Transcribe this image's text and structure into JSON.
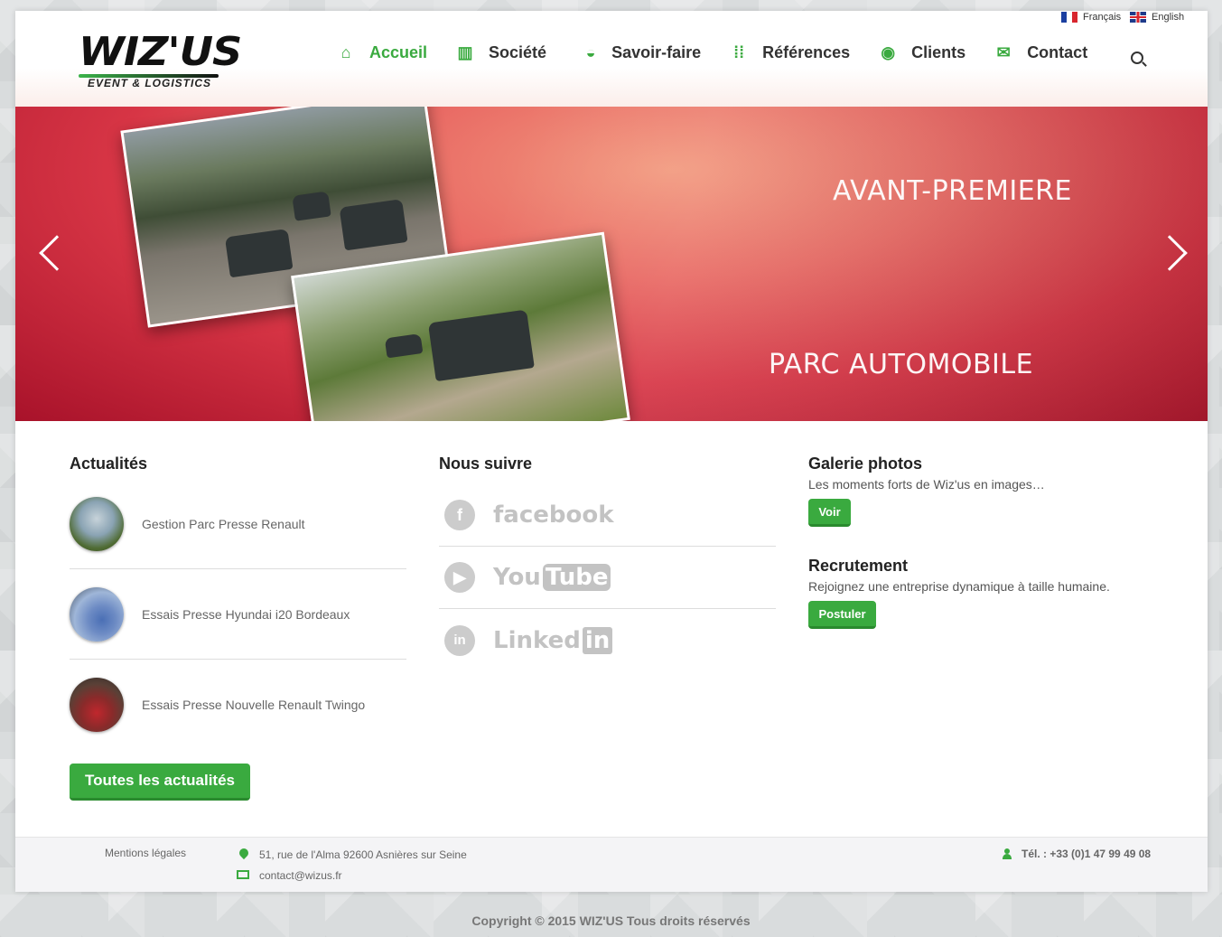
{
  "header": {
    "logo": {
      "main": "WIZ'US",
      "sub": "EVENT & LOGISTICS"
    },
    "lang": {
      "fr": "Français",
      "en": "English"
    },
    "nav": [
      {
        "label": "Accueil",
        "icon": "home-icon",
        "glyph": "⌂",
        "active": true
      },
      {
        "label": "Société",
        "icon": "book-icon",
        "glyph": "▥",
        "active": false
      },
      {
        "label": "Savoir-faire",
        "icon": "car-icon",
        "glyph": "◒",
        "active": false
      },
      {
        "label": "Références",
        "icon": "grid-icon",
        "glyph": "⁞⁞",
        "active": false
      },
      {
        "label": "Clients",
        "icon": "user-icon",
        "glyph": "◉",
        "active": false
      },
      {
        "label": "Contact",
        "icon": "mail-icon",
        "glyph": "✉",
        "active": false
      }
    ]
  },
  "slider": {
    "line1": "AVANT-PREMIERE",
    "line2": "PARC AUTOMOBILE"
  },
  "news": {
    "title": "Actualités",
    "items": [
      {
        "label": "Gestion Parc Presse Renault"
      },
      {
        "label": "Essais Presse Hyundai i20 Bordeaux"
      },
      {
        "label": "Essais Presse Nouvelle Renault Twingo"
      }
    ],
    "all_button": "Toutes les actualités"
  },
  "follow": {
    "title": "Nous suivre",
    "facebook": "facebook",
    "youtube_you": "You",
    "youtube_tube": "Tube",
    "linkedin_linked": "Linked",
    "linkedin_in": "in"
  },
  "gallery": {
    "title": "Galerie photos",
    "desc": "Les moments forts de Wiz'us en images…",
    "button": "Voir"
  },
  "jobs": {
    "title": "Recrutement",
    "desc": "Rejoignez une entreprise dynamique à taille humaine.",
    "button": "Postuler"
  },
  "footer": {
    "legal": "Mentions légales",
    "address": "51, rue de l'Alma 92600 Asnières sur Seine",
    "email": "contact@wizus.fr",
    "phone": "Tél. : +33 (0)1 47 99 49 08"
  },
  "copyright": "Copyright © 2015 WIZ'US Tous droits réservés",
  "colors": {
    "accent": "#3aaa3f",
    "slider": "#d73545"
  }
}
